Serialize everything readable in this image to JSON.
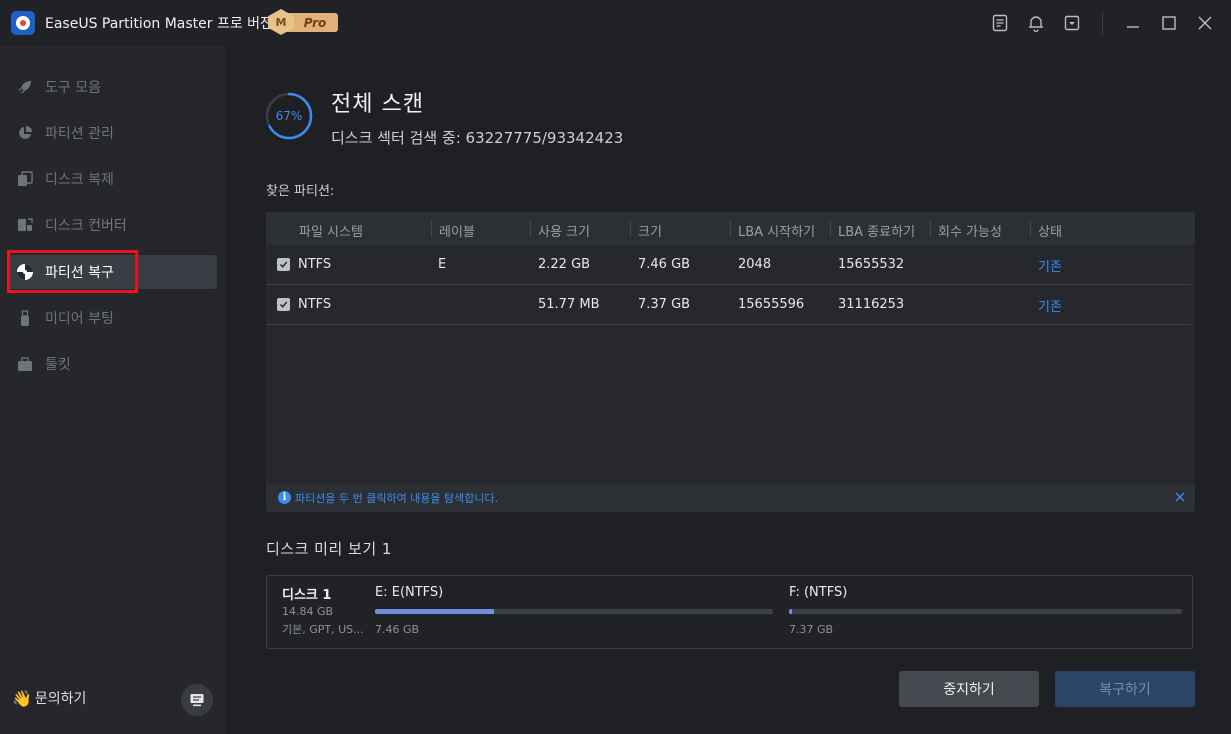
{
  "app": {
    "title": "EaseUS Partition Master 프로 버전",
    "badge_letter": "M",
    "badge_text": "Pro"
  },
  "sidebar": {
    "items": [
      {
        "label": "도구 모음",
        "icon": "rocket-icon",
        "active": false
      },
      {
        "label": "파티션 관리",
        "icon": "pie-chart-icon",
        "active": false
      },
      {
        "label": "디스크 복제",
        "icon": "clone-icon",
        "active": false
      },
      {
        "label": "디스크 컨버터",
        "icon": "convert-icon",
        "active": false
      },
      {
        "label": "파티션 복구",
        "icon": "recovery-icon",
        "active": true
      },
      {
        "label": "미디어 부팅",
        "icon": "usb-icon",
        "active": false
      },
      {
        "label": "툴킷",
        "icon": "toolkit-icon",
        "active": false
      }
    ],
    "inquiry_label": "문의하기",
    "highlight_color": "#e8141c"
  },
  "scan": {
    "progress_percent": 67,
    "progress_label": "67%",
    "title": "전체 스캔",
    "subtitle": "디스크 섹터 검색 중: 63227775/93342423"
  },
  "found_label": "찾은 파티션:",
  "table": {
    "columns": [
      "파일 시스템",
      "레이블",
      "사용 크기",
      "크기",
      "LBA 시작하기",
      "LBA 종료하기",
      "회수 가능성",
      "상태"
    ],
    "rows": [
      {
        "filesystem": "NTFS",
        "label": "E",
        "used": "2.22 GB",
        "size": "7.46 GB",
        "lba_start": "2048",
        "lba_end": "15655532",
        "recoverability": "",
        "status": "기존"
      },
      {
        "filesystem": "NTFS",
        "label": "",
        "used": "51.77 MB",
        "size": "7.37 GB",
        "lba_start": "15655596",
        "lba_end": "31116253",
        "recoverability": "",
        "status": "기존"
      }
    ],
    "hint": "파티션을 두 번 클릭하여 내용을 탐색합니다."
  },
  "preview": {
    "title": "디스크 미리 보기 1",
    "disk_name": "디스크 1",
    "disk_size": "14.84 GB",
    "disk_info": "기본, GPT, US...",
    "partitions": [
      {
        "label": "E: E(NTFS)",
        "size": "7.46 GB",
        "used_fraction": 0.3
      },
      {
        "label": "F: (NTFS)",
        "size": "7.37 GB",
        "used_fraction": 0.007
      }
    ]
  },
  "buttons": {
    "stop": "중지하기",
    "recover": "복구하기"
  },
  "colors": {
    "accent": "#3b8cf0",
    "bar_fill": "#6f8fd8"
  }
}
